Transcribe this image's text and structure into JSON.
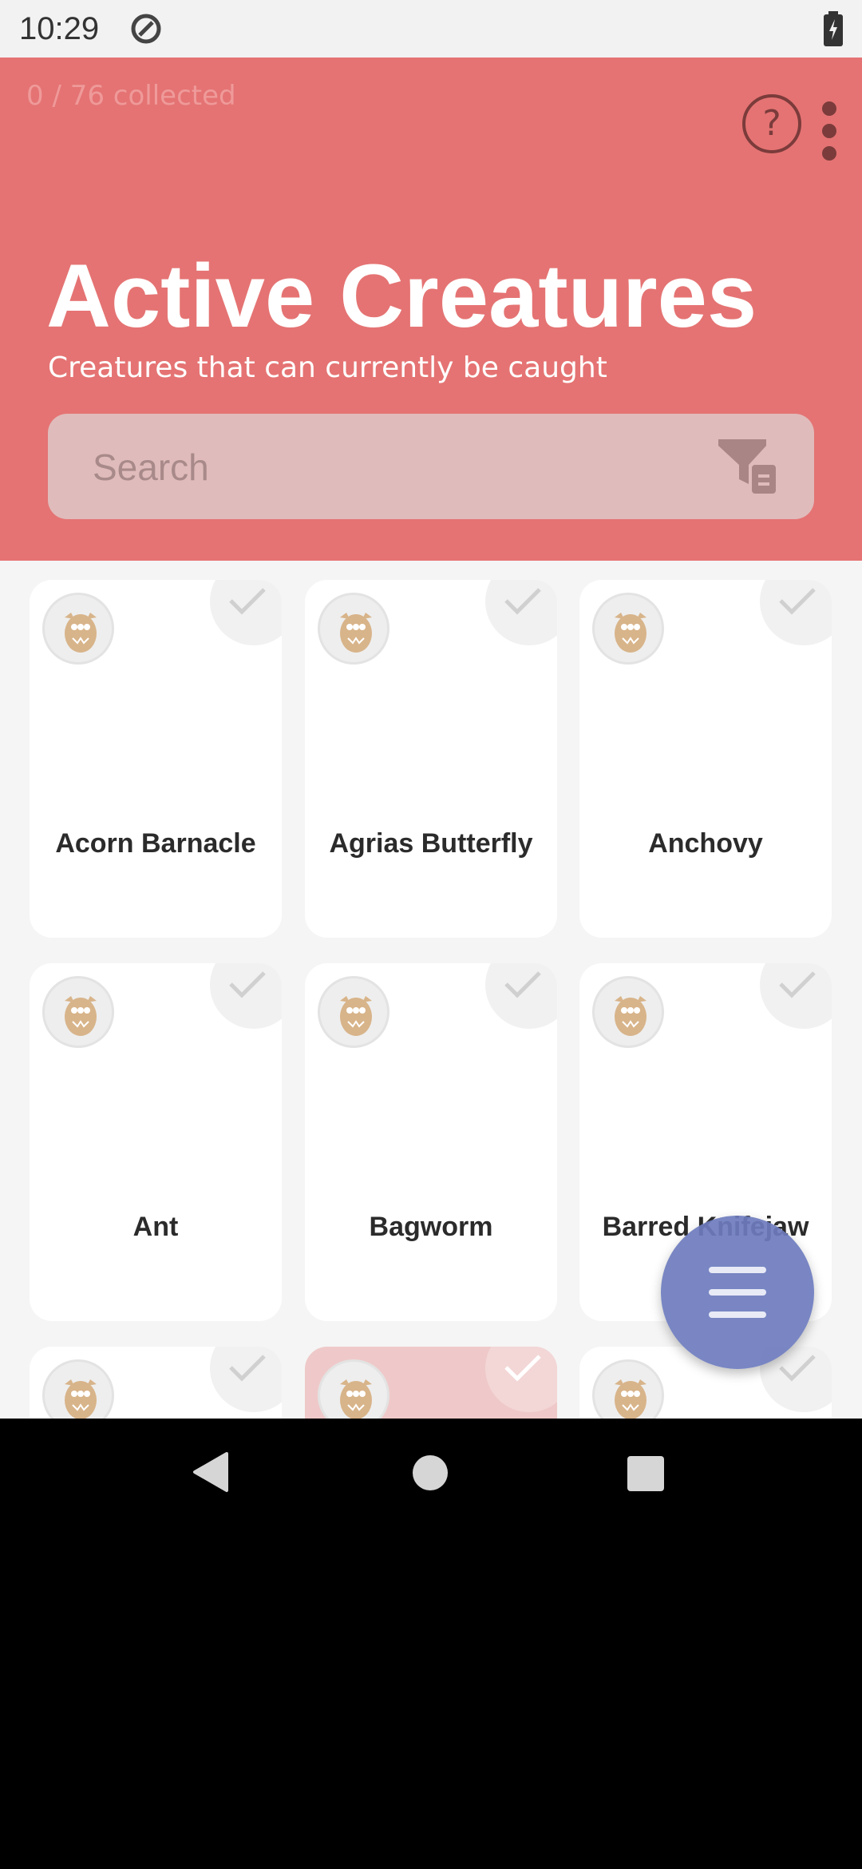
{
  "status": {
    "time": "10:29"
  },
  "header": {
    "collected_text": "0 / 76 collected",
    "help_label": "?",
    "title": "Active Creatures",
    "subtitle": "Creatures that can currently be caught"
  },
  "search": {
    "placeholder": "Search"
  },
  "creatures": [
    {
      "name": "Acorn Barnacle"
    },
    {
      "name": "Agrias Butterfly"
    },
    {
      "name": "Anchovy"
    },
    {
      "name": "Ant"
    },
    {
      "name": "Bagworm"
    },
    {
      "name": "Barred Knifejaw"
    },
    {
      "name": ""
    },
    {
      "name": ""
    },
    {
      "name": ""
    }
  ],
  "colors": {
    "header_bg": "#e57373",
    "fab_bg": "#6e7cbe",
    "highlight_card": "#efc9c9",
    "avatar_icon": "#d8b48a"
  },
  "icons": {
    "status_app": "circle-a-icon",
    "battery": "battery-charging-icon",
    "help": "help-circle-icon",
    "more": "more-vert-icon",
    "filter": "filter-list-icon",
    "avatar": "owl-icon",
    "check": "check-icon",
    "fab": "menu-icon",
    "nav_back": "back-triangle-icon",
    "nav_home": "home-circle-icon",
    "nav_recent": "recent-square-icon"
  }
}
